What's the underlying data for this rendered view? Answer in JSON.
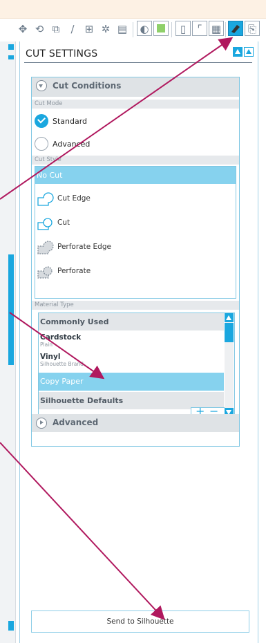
{
  "app": {
    "accent": "#1aa7df",
    "selection": "#86d2ee",
    "annotation_color": "#b0185e"
  },
  "toolbar": {
    "icons": [
      "move-icon",
      "rotate-icon",
      "replicate-icon",
      "draw-icon",
      "offset-icon",
      "fill-icon",
      "texture-icon",
      "store-icon",
      "library-icon",
      "page-icon",
      "registration-icon",
      "grid-icon",
      "send-icon",
      "trace-icon"
    ],
    "active": "send-icon"
  },
  "panel": {
    "title": "CUT SETTINGS",
    "cut_conditions": {
      "header": "Cut Conditions",
      "cut_mode_label": "Cut Mode",
      "modes": [
        {
          "label": "Standard",
          "selected": true
        },
        {
          "label": "Advanced",
          "selected": false
        }
      ],
      "cut_style_label": "Cut Style",
      "styles": [
        {
          "label": "No Cut",
          "selected": true
        },
        {
          "label": "Cut Edge",
          "icon": "cut-edge-icon"
        },
        {
          "label": "Cut",
          "icon": "cut-icon"
        },
        {
          "label": "Perforate Edge",
          "icon": "perforate-edge-icon"
        },
        {
          "label": "Perforate",
          "icon": "perforate-icon"
        }
      ],
      "material_type_label": "Material Type",
      "materials": [
        {
          "kind": "category",
          "label": "Commonly Used"
        },
        {
          "kind": "item",
          "label": "Cardstock",
          "sub": "Plain"
        },
        {
          "kind": "item",
          "label": "Vinyl",
          "sub": "Silhouette Brand"
        },
        {
          "kind": "selected",
          "label": "Copy Paper"
        },
        {
          "kind": "category",
          "label": "Silhouette Defaults"
        }
      ]
    },
    "advanced": {
      "header": "Advanced"
    },
    "send_button": "Send to Silhouette"
  }
}
